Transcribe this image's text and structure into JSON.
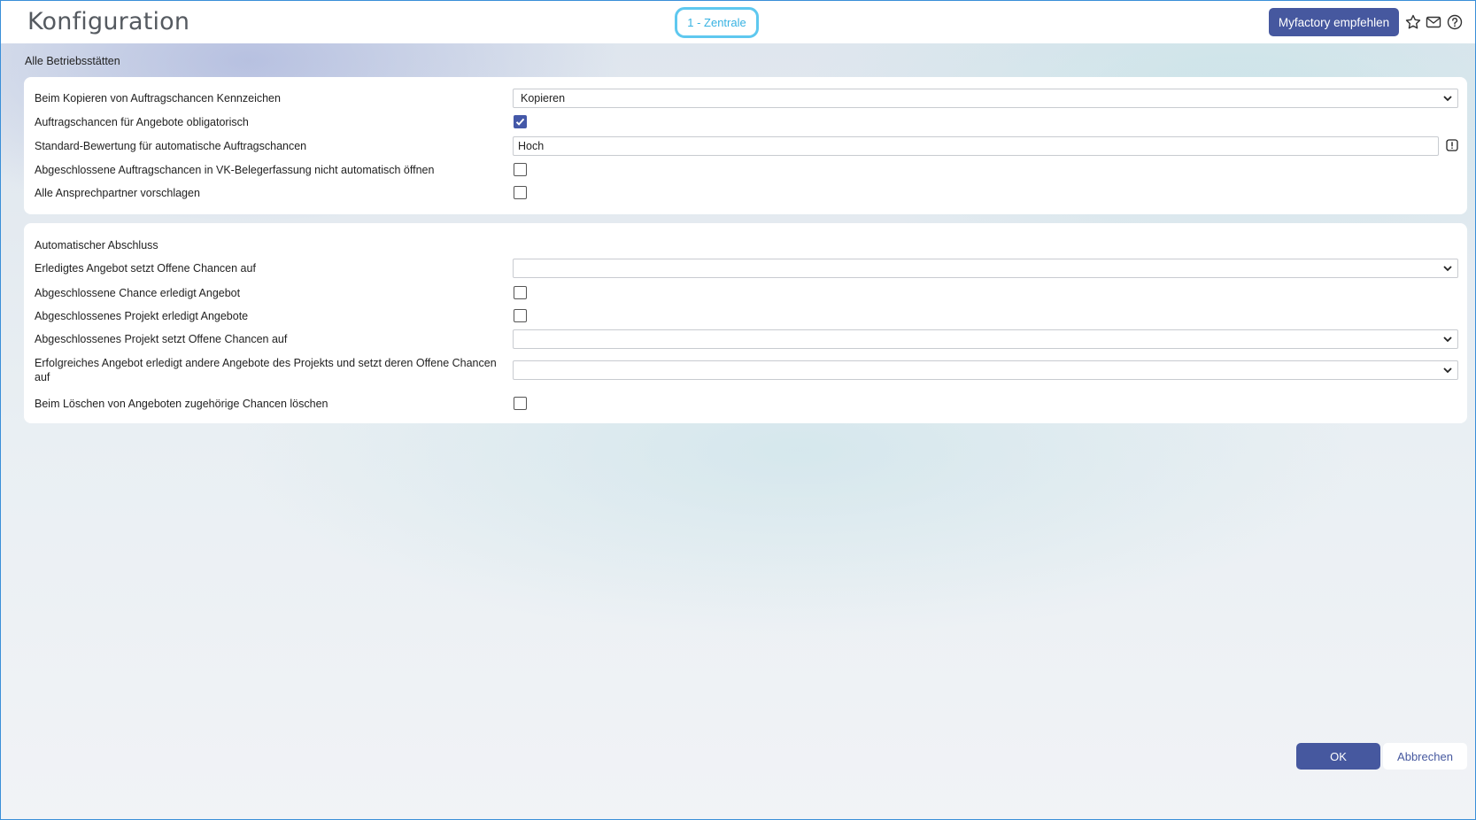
{
  "header": {
    "title": "Konfiguration",
    "site": "1 - Zentrale",
    "recommend_label": "Myfactory empfehlen",
    "icons": [
      "star-icon",
      "mail-icon",
      "help-icon"
    ]
  },
  "section_label": "Alle Betriebsstätten",
  "panel1": {
    "rows": [
      {
        "label": "Beim Kopieren von Auftragschancen Kennzeichen",
        "type": "select",
        "value": "Kopieren"
      },
      {
        "label": "Auftragschancen für Angebote obligatorisch",
        "type": "checkbox",
        "checked": true
      },
      {
        "label": "Standard-Bewertung für automatische Auftragschancen",
        "type": "text",
        "value": "Hoch"
      },
      {
        "label": "Abgeschlossene Auftragschancen in VK-Belegerfassung nicht automatisch öffnen",
        "type": "checkbox",
        "checked": false
      },
      {
        "label": "Alle Ansprechpartner vorschlagen",
        "type": "checkbox",
        "checked": false
      }
    ]
  },
  "panel2": {
    "heading": "Automatischer Abschluss",
    "rows": [
      {
        "label": "Erledigtes Angebot setzt Offene Chancen auf",
        "type": "select",
        "value": ""
      },
      {
        "label": "Abgeschlossene Chance erledigt Angebot",
        "type": "checkbox",
        "checked": false
      },
      {
        "label": "Abgeschlossenes Projekt erledigt Angebote",
        "type": "checkbox",
        "checked": false
      },
      {
        "label": "Abgeschlossenes Projekt setzt Offene Chancen auf",
        "type": "select",
        "value": ""
      },
      {
        "label": "Erfolgreiches Angebot erledigt andere Angebote des Projekts und setzt deren Offene Chancen auf",
        "type": "select",
        "value": ""
      },
      {
        "label": "Beim Löschen von Angeboten zugehörige Chancen löschen",
        "type": "checkbox",
        "checked": false
      }
    ]
  },
  "footer": {
    "ok_label": "OK",
    "cancel_label": "Abbrechen"
  },
  "colors": {
    "accent": "#46589f",
    "site_border": "#5ec8ef"
  }
}
